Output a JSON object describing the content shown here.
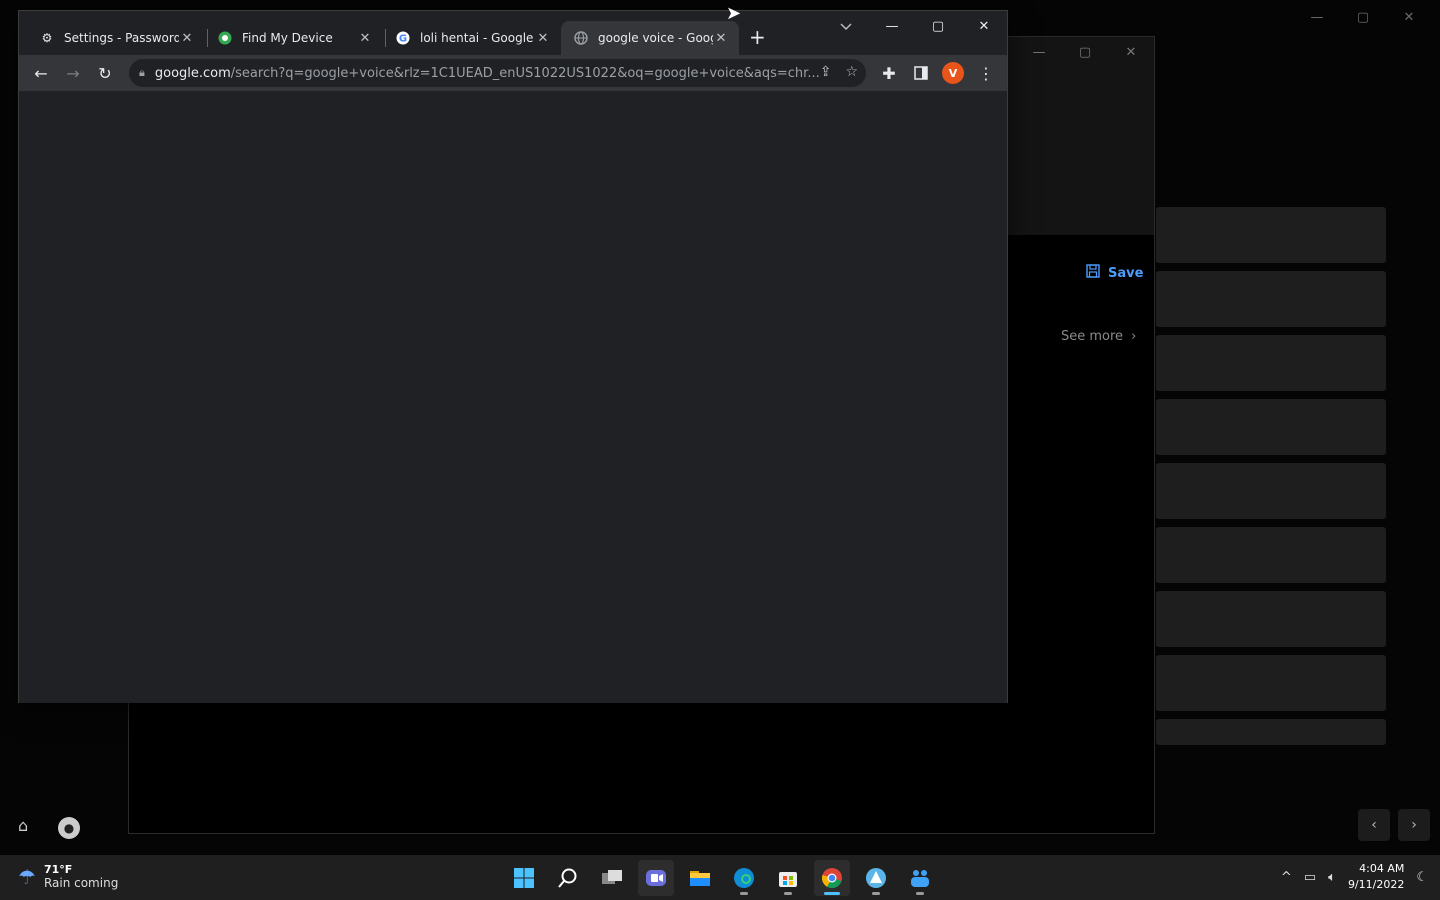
{
  "browser": {
    "tabs": [
      {
        "title": "Settings - Password M",
        "icon": "gear-icon",
        "active": false
      },
      {
        "title": "Find My Device",
        "icon": "find-device-icon",
        "active": false
      },
      {
        "title": "loli hentai - Google S",
        "icon": "google-icon",
        "active": false
      },
      {
        "title": "google voice - Goog",
        "icon": "globe-icon",
        "active": true
      }
    ],
    "close_glyph": "✕",
    "new_tab_glyph": "+",
    "address": {
      "host": "google.com",
      "path": "/search?q=google+voice&rlz=1C1UEAD_enUS1022US1022&oq=google+voice&aqs=chr..."
    },
    "profile_initial": "V"
  },
  "background_window": {
    "save_label": "Save",
    "see_more_label": "See more"
  },
  "taskbar": {
    "weather_temp": "71°F",
    "weather_condition": "Rain coming",
    "clock_time": "4:04 AM",
    "clock_date": "9/11/2022",
    "apps": [
      "start-icon",
      "search-icon",
      "task-view-icon",
      "chat-icon",
      "file-explorer-icon",
      "edge-icon",
      "store-icon",
      "chrome-icon",
      "app-icon",
      "teams-icon"
    ]
  },
  "colors": {
    "accent": "#4c9eff",
    "chrome_bg": "#202124",
    "profile": "#e8541a"
  }
}
